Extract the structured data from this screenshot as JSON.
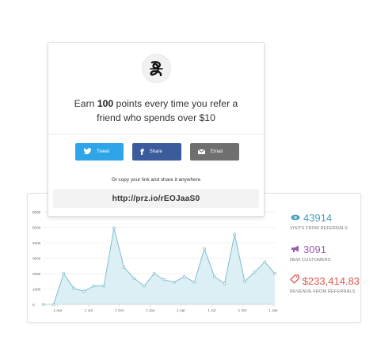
{
  "referral_card": {
    "headline_prefix": "Earn ",
    "headline_points": "100",
    "headline_suffix": " points every time you refer a friend who spends over $10",
    "share_buttons": [
      {
        "label": "Tweet",
        "icon": "twitter-bird-icon",
        "color": "#2da5e8"
      },
      {
        "label": "Share",
        "icon": "facebook-f-icon",
        "color": "#3b5b9d"
      },
      {
        "label": "Email",
        "icon": "envelope-icon",
        "color": "#6f6f6f"
      }
    ],
    "copy_prompt": "Or copy your link and share it anywhere",
    "referral_link": "http://prz.io/rEOJaaS0"
  },
  "stats": [
    {
      "icon": "eye-icon",
      "value": "43914",
      "label": "VISITS FROM REFERRALS",
      "color": "#4aa0c3"
    },
    {
      "icon": "megaphone-icon",
      "value": "3091",
      "label": "NEW CUSTOMERS",
      "color": "#9b5db0"
    },
    {
      "icon": "tag-icon",
      "value": "$233,414.83",
      "label": "REVENUE FROM REFERRALS",
      "color": "#e0584e"
    }
  ],
  "chart_data": {
    "type": "area",
    "ylim": [
      0,
      6000
    ],
    "yticks": [
      "0",
      "1000",
      "2000",
      "3000",
      "4000",
      "5000",
      "6000"
    ],
    "xtick_labels": [
      "1 Apr",
      "1 Jul",
      "1 Oct",
      "1 Jan",
      "1 Apr",
      "1 Jul",
      "1 Oct",
      "1 Jan"
    ],
    "series": [
      {
        "color": "#7fbfcc",
        "fill": "#dceff4",
        "values": [
          0,
          0,
          2000,
          1050,
          850,
          1200,
          1200,
          4950,
          2400,
          1700,
          1200,
          2000,
          1600,
          1450,
          1800,
          1450,
          3600,
          1800,
          1350,
          4550,
          1500,
          2100,
          2750,
          2000
        ]
      }
    ]
  }
}
